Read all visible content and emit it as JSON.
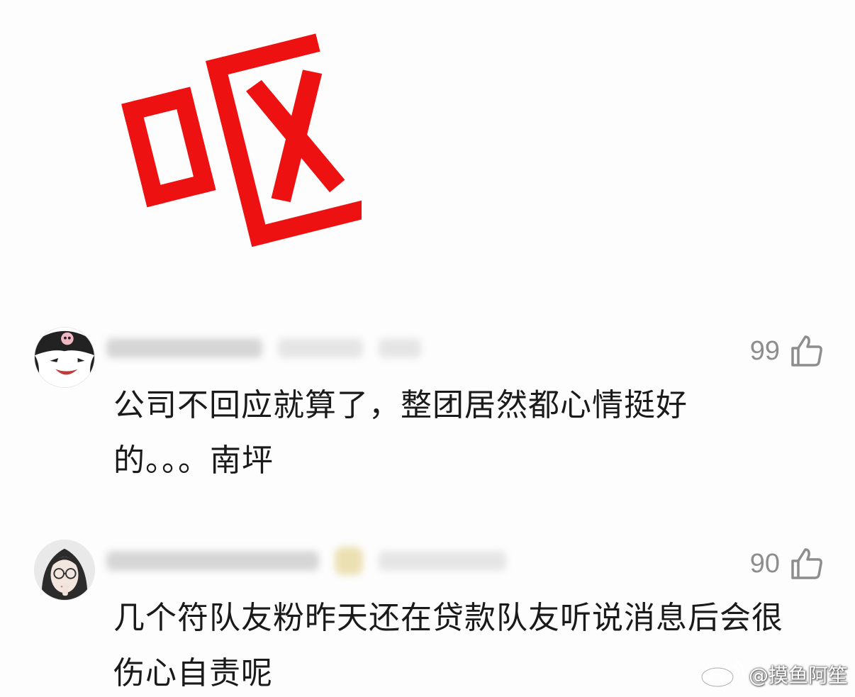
{
  "header_image": {
    "character": "呕",
    "color": "#ee1111"
  },
  "comments": [
    {
      "avatar_icon": "cartoon-skull-character-avatar",
      "username_blurred": true,
      "likes": "99",
      "text": "公司不回应就算了，整团居然都心情挺好\n的。。。南坪"
    },
    {
      "avatar_icon": "girl-with-glasses-avatar",
      "username_blurred": true,
      "likes": "90",
      "text": "几个符队友粉昨天还在贷款队友听说消息后会很\n伤心自责呢"
    }
  ],
  "watermark": {
    "icon": "weibo-logo-icon",
    "text": "@摸鱼阿笙"
  },
  "colors": {
    "background": "#fdfdfd",
    "text": "#1a1a1a",
    "like": "#8d8d8d",
    "accent_red": "#ee1111"
  }
}
